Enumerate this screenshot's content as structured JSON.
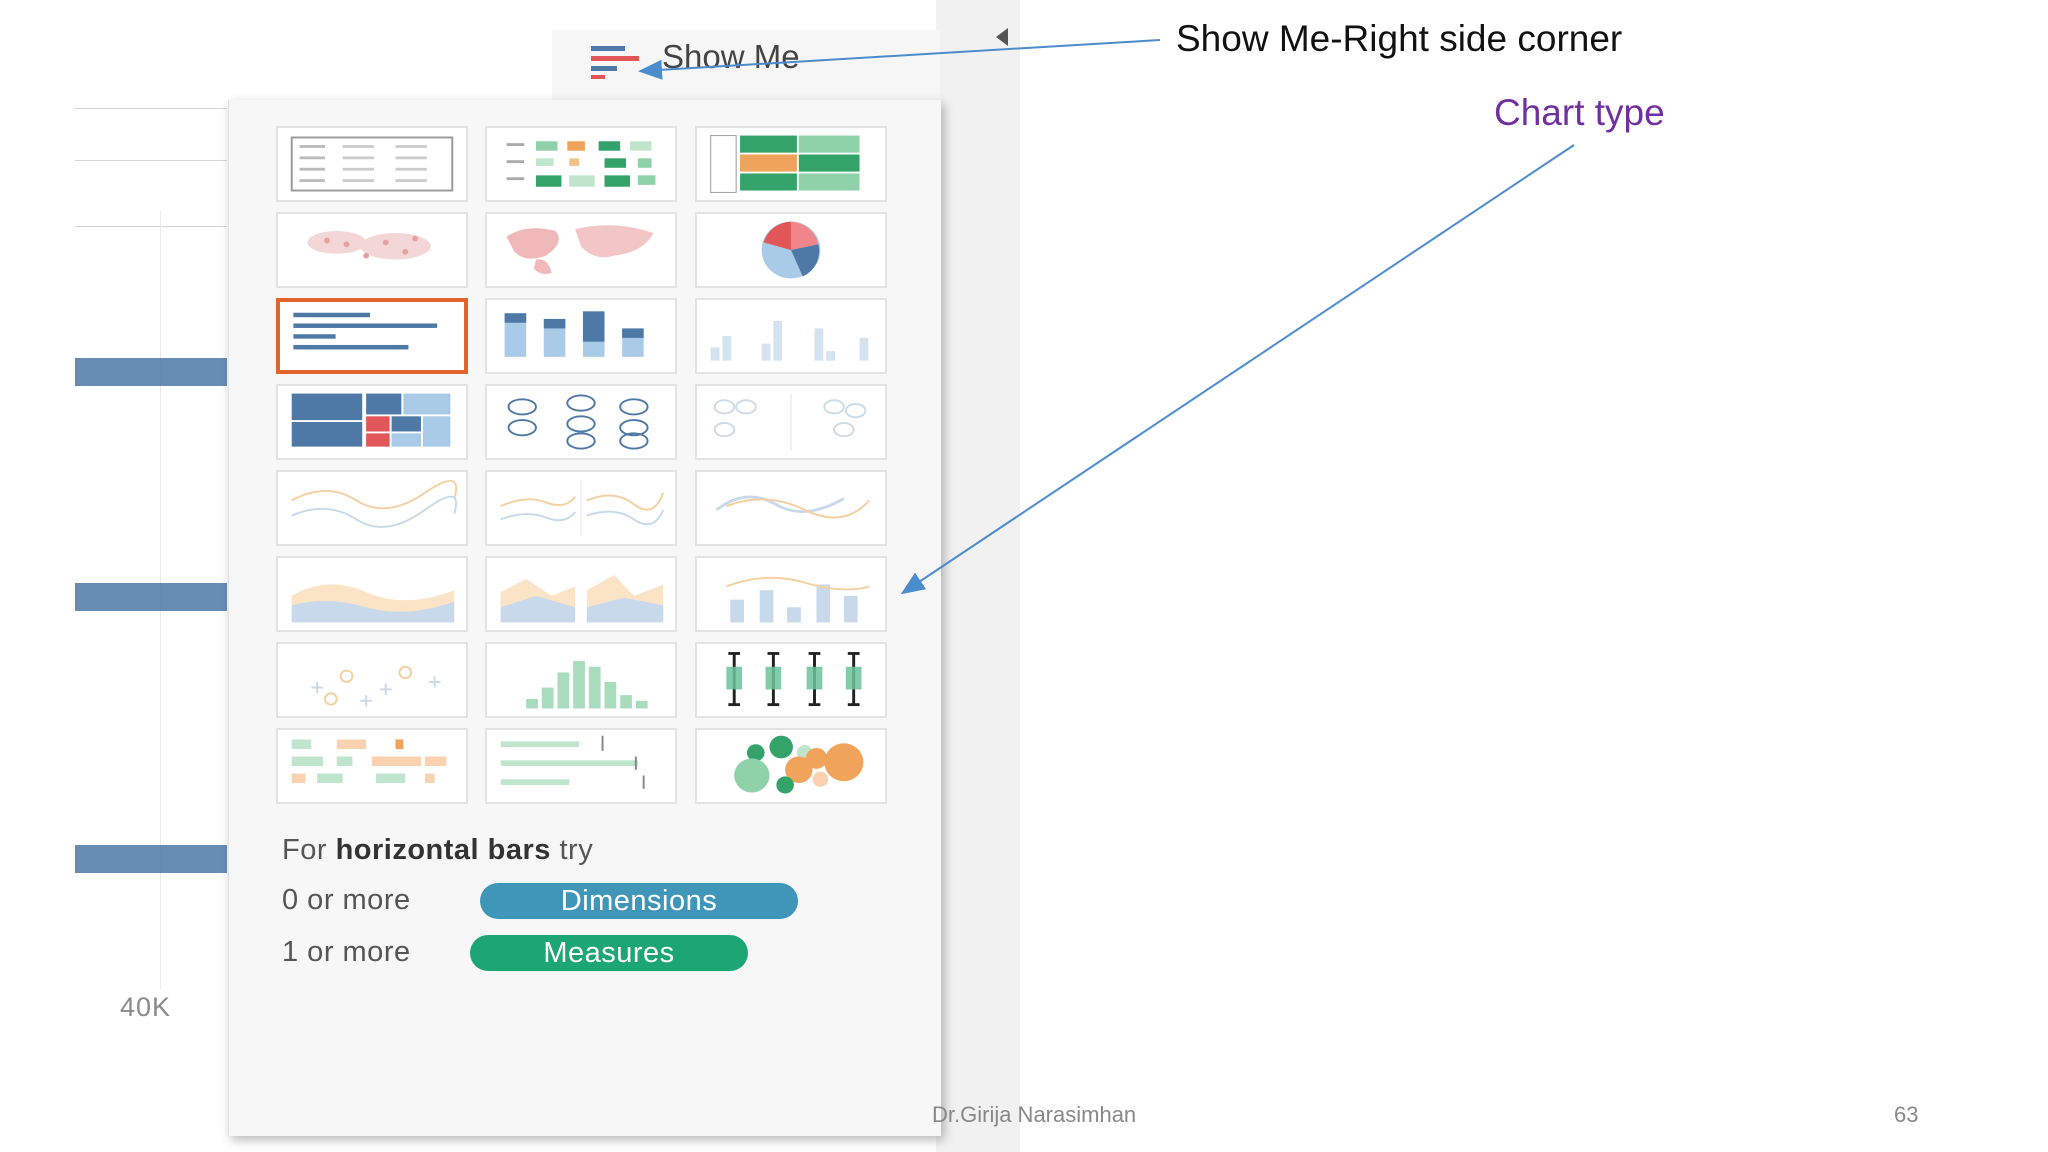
{
  "show_me_tab": {
    "label": "Show Me",
    "icon": "show-me-bars-icon"
  },
  "chart_types": [
    "text-table",
    "heat-map",
    "highlight-table",
    "symbol-map",
    "filled-map",
    "pie-chart",
    "horizontal-bars",
    "stacked-bars",
    "side-by-side-bars",
    "treemap",
    "circle-views",
    "side-by-side-circles",
    "continuous-lines",
    "discrete-lines",
    "dual-lines",
    "area-continuous",
    "area-discrete",
    "dual-combination",
    "scatter-plot",
    "histogram",
    "box-and-whisker",
    "gantt-chart",
    "bullet-graph",
    "packed-bubbles"
  ],
  "selected_chart": "horizontal-bars",
  "hint": {
    "prefix": "For ",
    "bold": "horizontal bars",
    "suffix": " try"
  },
  "requirements": [
    {
      "label": "0 or more",
      "pill": "Dimensions",
      "color": "#4096b8"
    },
    {
      "label": "1 or more",
      "pill": "Measures",
      "color": "#1ba673"
    }
  ],
  "axis_tick": "40K",
  "annotations": {
    "show_me_location": "Show Me-Right side corner",
    "chart_type": "Chart type"
  },
  "footer": {
    "author": "Dr.Girija Narasimhan",
    "page": "63"
  },
  "colors": {
    "selected_border": "#e0642c",
    "annotation_purple": "#7030a0",
    "arrow": "#4a8ccc",
    "bar": "#4e79a7"
  }
}
